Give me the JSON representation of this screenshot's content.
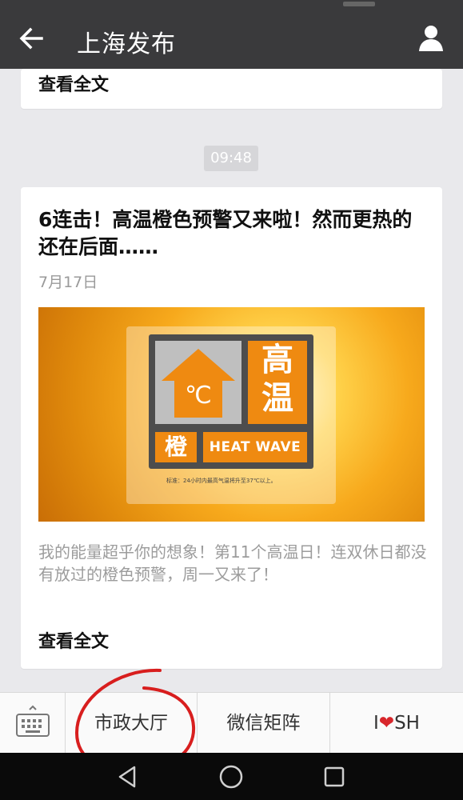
{
  "header": {
    "title": "上海发布"
  },
  "top_card": {
    "read_full": "查看全文"
  },
  "timestamp": "09:48",
  "article": {
    "title": "6连击！高温橙色预警又来啦！然而更热的还在后面……",
    "date": "7月17日",
    "image": {
      "big_chars": [
        "高",
        "温"
      ],
      "small_char": "橙",
      "unit": "℃",
      "banner": "HEAT WAVE",
      "caption": "标准：24小时内最高气温将升至37℃以上。"
    },
    "summary": "我的能量超乎你的想象！第11个高温日！连双休日都没有放过的橙色预警，周一又来了！",
    "read_full": "查看全文"
  },
  "menu": {
    "item1": "市政大厅",
    "item2": "微信矩阵",
    "item3_prefix": "I",
    "item3_heart": "❤",
    "item3_suffix": "SH"
  },
  "icons": {
    "back": "arrow-left-icon",
    "profile": "person-icon",
    "keyboard": "keyboard-icon",
    "nav_back": "triangle-back-icon",
    "nav_home": "circle-home-icon",
    "nav_recent": "square-recent-icon"
  },
  "colors": {
    "titlebar": "#3a3a3c",
    "warning_orange": "#ef8a11",
    "annotation_red": "#d81e1e"
  }
}
